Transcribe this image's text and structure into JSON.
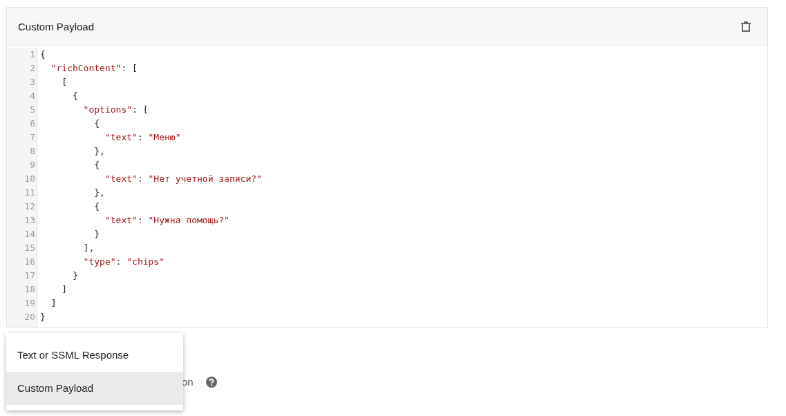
{
  "card": {
    "title": "Custom Payload"
  },
  "editor": {
    "lines": [
      {
        "number": "1",
        "tokens": [
          {
            "kind": "punct",
            "text": "{"
          }
        ]
      },
      {
        "number": "2",
        "tokens": [
          {
            "kind": "string",
            "text": "  \"richContent\""
          },
          {
            "kind": "punct",
            "text": ": ["
          }
        ]
      },
      {
        "number": "3",
        "tokens": [
          {
            "kind": "punct",
            "text": "    ["
          }
        ]
      },
      {
        "number": "4",
        "tokens": [
          {
            "kind": "punct",
            "text": "      {"
          }
        ]
      },
      {
        "number": "5",
        "tokens": [
          {
            "kind": "string",
            "text": "        \"options\""
          },
          {
            "kind": "punct",
            "text": ": ["
          }
        ]
      },
      {
        "number": "6",
        "tokens": [
          {
            "kind": "punct",
            "text": "          {"
          }
        ]
      },
      {
        "number": "7",
        "tokens": [
          {
            "kind": "string",
            "text": "            \"text\""
          },
          {
            "kind": "punct",
            "text": ": "
          },
          {
            "kind": "string",
            "text": "\"Меню\""
          }
        ]
      },
      {
        "number": "8",
        "tokens": [
          {
            "kind": "punct",
            "text": "          },"
          }
        ]
      },
      {
        "number": "9",
        "tokens": [
          {
            "kind": "punct",
            "text": "          {"
          }
        ]
      },
      {
        "number": "10",
        "tokens": [
          {
            "kind": "string",
            "text": "            \"text\""
          },
          {
            "kind": "punct",
            "text": ": "
          },
          {
            "kind": "string",
            "text": "\"Нет учетной записи?\""
          }
        ]
      },
      {
        "number": "11",
        "tokens": [
          {
            "kind": "punct",
            "text": "          },"
          }
        ]
      },
      {
        "number": "12",
        "tokens": [
          {
            "kind": "punct",
            "text": "          {"
          }
        ]
      },
      {
        "number": "13",
        "tokens": [
          {
            "kind": "string",
            "text": "            \"text\""
          },
          {
            "kind": "punct",
            "text": ": "
          },
          {
            "kind": "string",
            "text": "\"Нужна помощь?\""
          }
        ]
      },
      {
        "number": "14",
        "tokens": [
          {
            "kind": "punct",
            "text": "          }"
          }
        ]
      },
      {
        "number": "15",
        "tokens": [
          {
            "kind": "punct",
            "text": "        ],"
          }
        ]
      },
      {
        "number": "16",
        "tokens": [
          {
            "kind": "string",
            "text": "        \"type\""
          },
          {
            "kind": "punct",
            "text": ": "
          },
          {
            "kind": "string",
            "text": "\"chips\""
          }
        ]
      },
      {
        "number": "17",
        "tokens": [
          {
            "kind": "punct",
            "text": "      }"
          }
        ]
      },
      {
        "number": "18",
        "tokens": [
          {
            "kind": "punct",
            "text": "    ]"
          }
        ]
      },
      {
        "number": "19",
        "tokens": [
          {
            "kind": "punct",
            "text": "  ]"
          }
        ]
      },
      {
        "number": "20",
        "tokens": [
          {
            "kind": "punct",
            "text": "}"
          }
        ]
      }
    ]
  },
  "hidden_option": {
    "label": "on"
  },
  "menu": {
    "items": [
      {
        "label": "Text or SSML Response",
        "selected": false
      },
      {
        "label": "Custom Payload",
        "selected": true
      }
    ]
  }
}
